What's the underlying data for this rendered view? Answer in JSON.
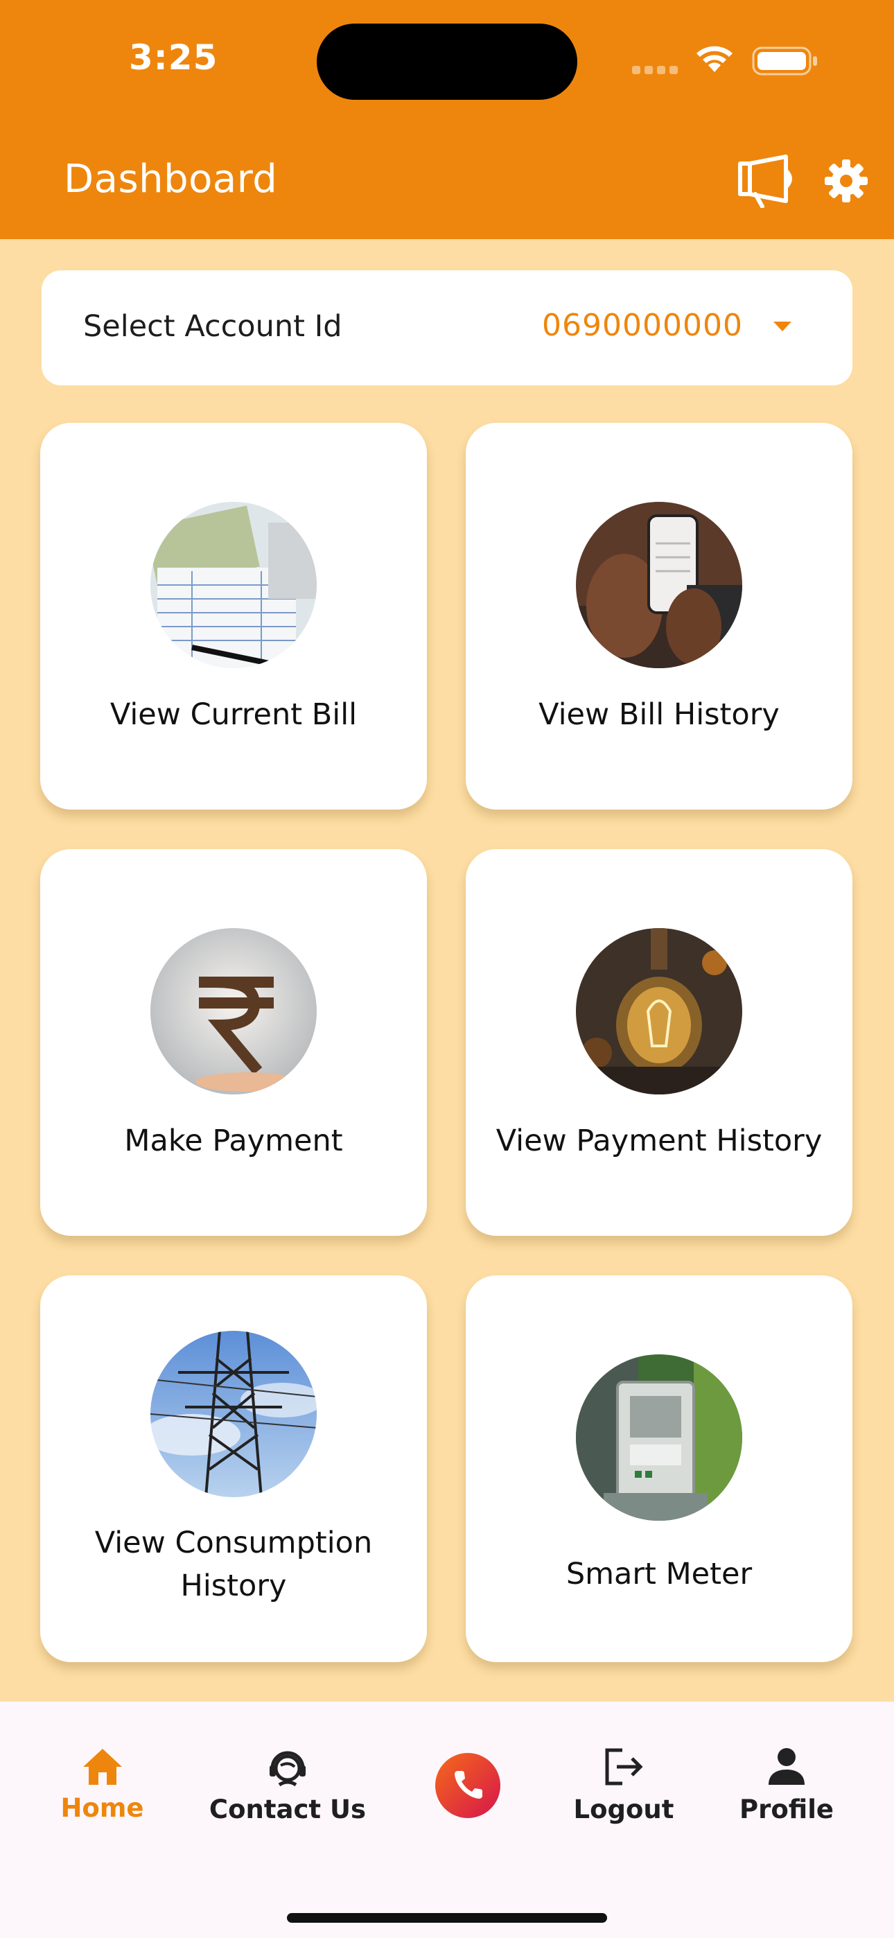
{
  "status_bar": {
    "time": "3:25"
  },
  "header": {
    "title": "Dashboard",
    "announce_icon": "megaphone-icon",
    "settings_icon": "gear-icon",
    "background": "#EE860D"
  },
  "account": {
    "label": "Select Account Id",
    "selected_value": "0690000000",
    "value_color": "#EE860D"
  },
  "tiles": [
    {
      "label": "View Current Bill",
      "image": "bill-papers-photo"
    },
    {
      "label": "View Bill History",
      "image": "phone-in-hand-photo"
    },
    {
      "label": "Make Payment",
      "image": "rupee-symbol-photo"
    },
    {
      "label": "View Payment History",
      "image": "light-bulb-photo"
    },
    {
      "label": "View Consumption History",
      "image": "power-tower-photo"
    },
    {
      "label": "Smart Meter",
      "image": "electric-meter-photo"
    }
  ],
  "bottom_nav": {
    "items": [
      {
        "label": "Home",
        "icon": "home-icon",
        "active": true
      },
      {
        "label": "Contact Us",
        "icon": "support-agent-icon"
      },
      {
        "label": "",
        "icon": "phone-call-icon"
      },
      {
        "label": "Logout",
        "icon": "logout-icon"
      },
      {
        "label": "Profile",
        "icon": "person-icon"
      }
    ],
    "active_color": "#EE860D"
  },
  "colors": {
    "page_background": "#FDDDA3",
    "accent": "#EE860D"
  }
}
